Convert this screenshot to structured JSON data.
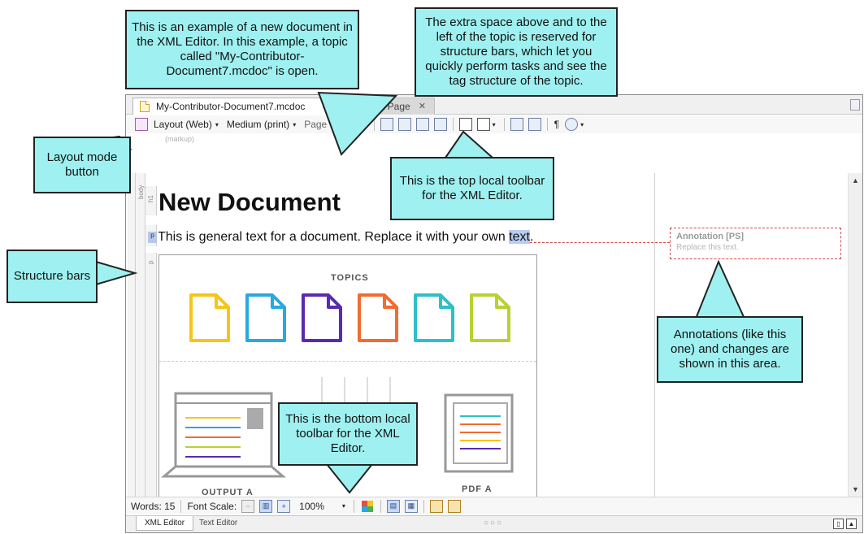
{
  "editor": {
    "tabs": [
      {
        "label": "My-Contributor-Document7.mcdoc",
        "close": "✕",
        "active": true
      },
      {
        "label": "Start Page",
        "close": "✕",
        "active": false
      }
    ],
    "top_toolbar": {
      "layout_mode": "Layout (Web)",
      "medium": "Medium (print)",
      "page_layout": "Page Layout",
      "dropdown_glyph": "▾",
      "pilcrow": "¶"
    },
    "markup_hint": "(markup)",
    "structure_bars": [
      "body",
      "h1",
      "p",
      "p"
    ],
    "document": {
      "heading": "New Document",
      "para_before": "This is general text for a document. Replace it with your own ",
      "para_highlight": "text",
      "para_after": ".",
      "p_marker": "p",
      "image": {
        "topics_label": "TOPICS",
        "topic_colors": [
          "#f5c518",
          "#2aa8e0",
          "#5a2ab0",
          "#f26b30",
          "#2ebfc7",
          "#b7d332"
        ],
        "output_label": "OUTPUT A",
        "pdf_label": "PDF A"
      }
    },
    "annotation": {
      "title": "Annotation [PS]",
      "body": "Replace this text."
    },
    "bottom_toolbar": {
      "words_label": "Words: 15",
      "font_scale_label": "Font Scale:",
      "zoom_value": "100%",
      "zoom_dropdown": "▾"
    },
    "mode_tabs": [
      "XML Editor",
      "Text Editor"
    ],
    "mode_dots": "○○○"
  },
  "callouts": {
    "new_document": "This is an example of a new document in the XML Editor. In this example, a topic called \"My-Contributor-Document7.mcdoc\" is open.",
    "extra_space": "The extra space above and to the left of the topic is reserved for structure bars, which let you quickly perform tasks and see the tag structure of the topic.",
    "layout_mode": "Layout mode button",
    "top_toolbar": "This is the top local toolbar for the XML Editor.",
    "structure_bars": "Structure bars",
    "annotations": "Annotations (like this one) and changes are shown in this area.",
    "bottom_toolbar": "This is the bottom local toolbar for the XML Editor."
  },
  "colors": {
    "callout_fill": "#9ff0f0",
    "annotation_border": "#d04a4a",
    "highlight": "#b8cdf0"
  }
}
